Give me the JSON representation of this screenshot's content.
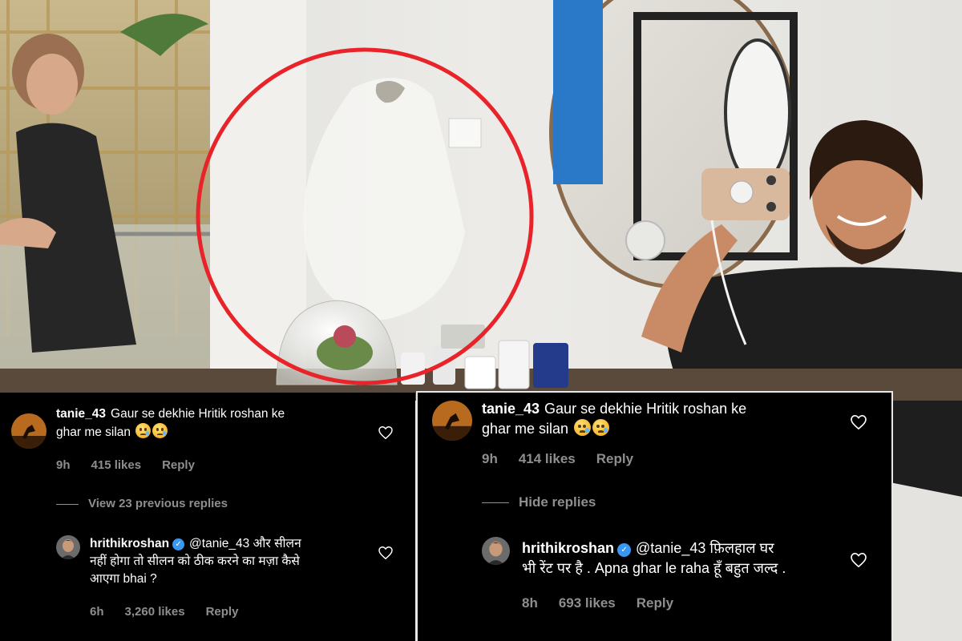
{
  "left_panel": {
    "comment": {
      "username": "tanie_43",
      "text_line1": "Gaur se dekhie Hritik roshan ke",
      "text_line2": "ghar me silan",
      "time": "9h",
      "likes": "415 likes",
      "reply": "Reply"
    },
    "view_replies": "View 23 previous replies",
    "reply": {
      "username": "hrithikroshan",
      "text_line1": "@tanie_43 और सीलन",
      "text_line2": "नहीं होगा तो सीलन को ठीक करने का मज़ा कैसे",
      "text_line3": "आएगा bhai ?",
      "time": "6h",
      "likes": "3,260 likes",
      "reply": "Reply"
    }
  },
  "right_panel": {
    "comment": {
      "username": "tanie_43",
      "text_line1": "Gaur se dekhie Hritik roshan ke",
      "text_line2": "ghar me silan",
      "time": "9h",
      "likes": "414 likes",
      "reply": "Reply"
    },
    "hide_replies": "Hide replies",
    "reply": {
      "username": "hrithikroshan",
      "text_line1": "@tanie_43 फ़िलहाल घर",
      "text_line2": "भी रेंट पर है . Apna ghar le raha हूँ बहुत जल्द .",
      "time": "8h",
      "likes": "693 likes",
      "reply": "Reply"
    }
  },
  "colors": {
    "panel_bg": "#000000",
    "text": "#ffffff",
    "meta": "#8e8e8e",
    "verified": "#3897f0",
    "highlight_circle": "#e8232a"
  },
  "icons": [
    "heart-outline-icon",
    "verified-badge-icon",
    "crying-face-emoji"
  ]
}
